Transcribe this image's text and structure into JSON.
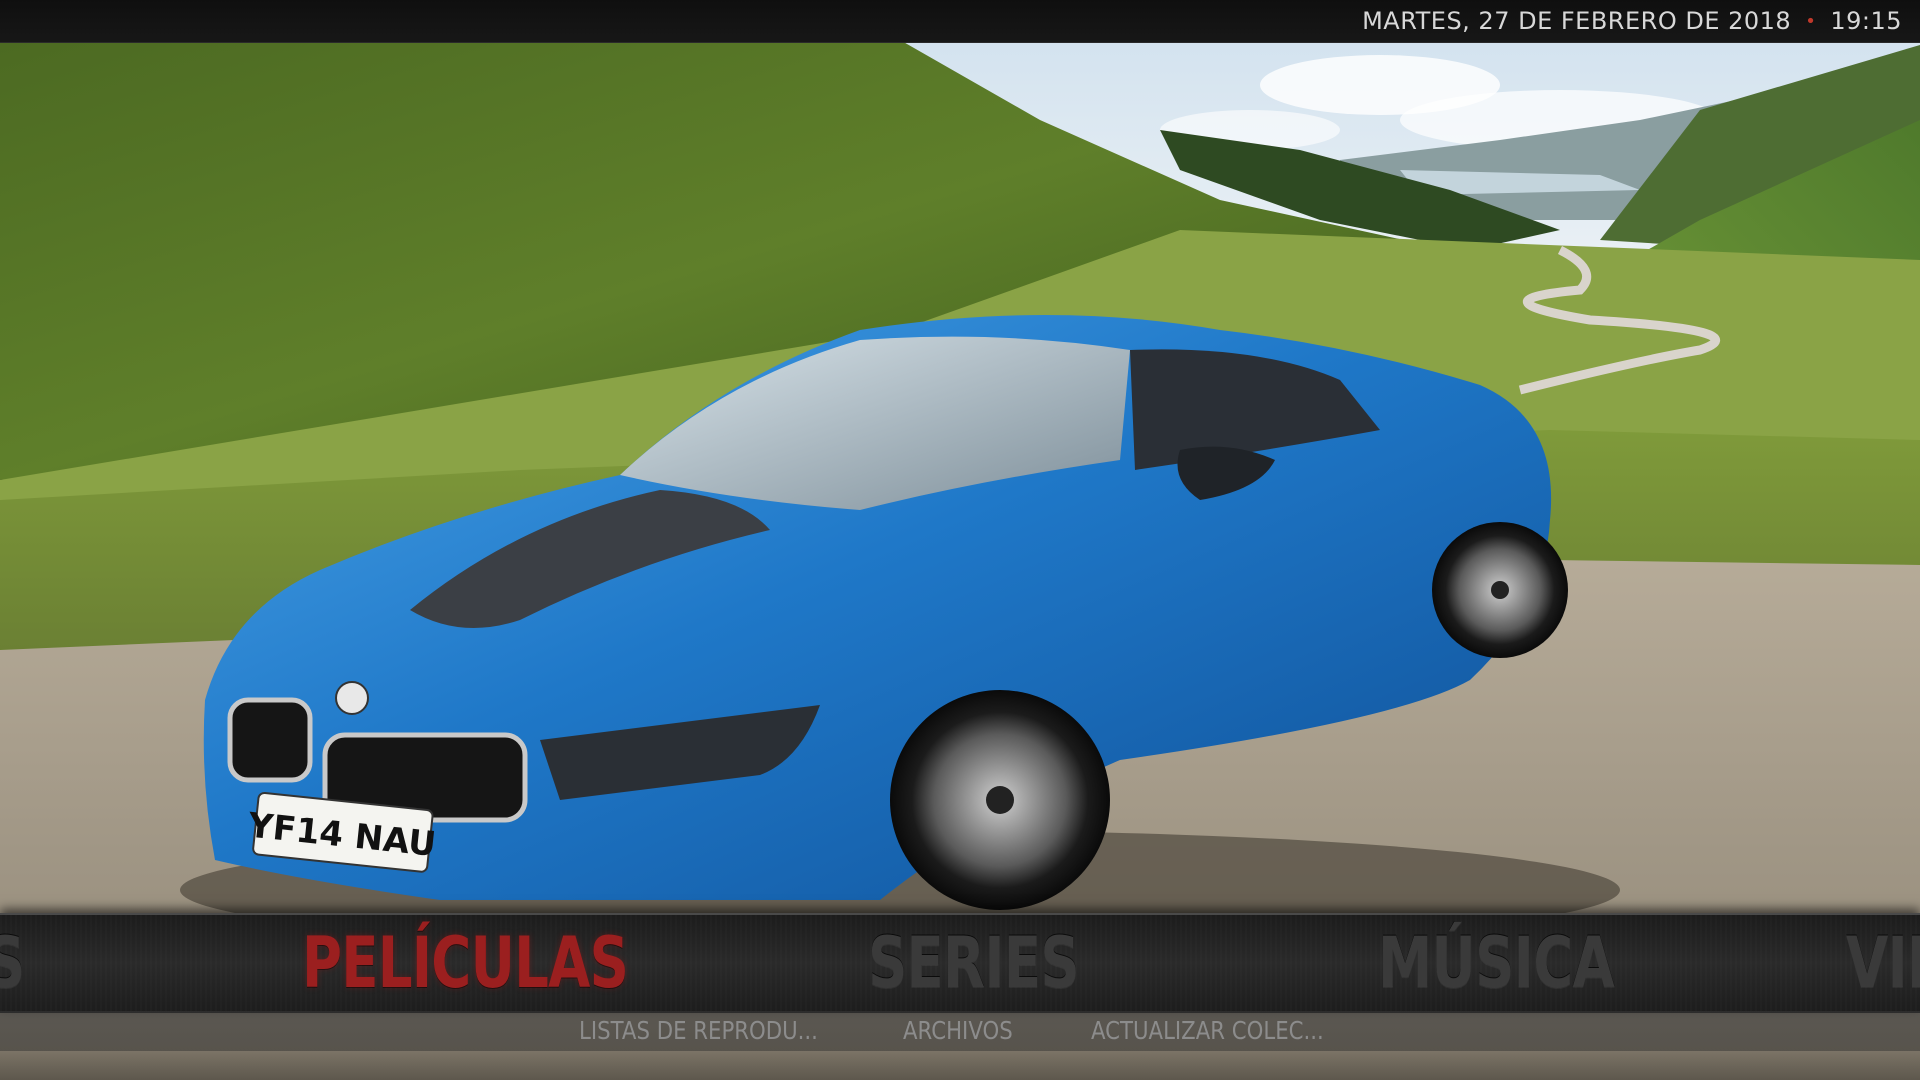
{
  "topbar": {
    "date": "MARTES, 27 DE FEBRERO DE 2018",
    "separator": "•",
    "time": "19:15"
  },
  "main_menu": {
    "items": [
      {
        "label": "S"
      },
      {
        "label": "PELÍCULAS"
      },
      {
        "label": "SERIES"
      },
      {
        "label": "MÚSICA"
      },
      {
        "label": "VID"
      }
    ],
    "active_color": "#9b1f1f",
    "inactive_color": "#3a3a3a"
  },
  "sub_menu": {
    "items": [
      {
        "label": "LISTAS DE REPRODU..."
      },
      {
        "label": "ARCHIVOS"
      },
      {
        "label": "ACTUALIZAR COLEC..."
      }
    ]
  },
  "background": {
    "subject": "car-image",
    "plate": "YF14 NAU",
    "car_color": "#1f78c8"
  }
}
